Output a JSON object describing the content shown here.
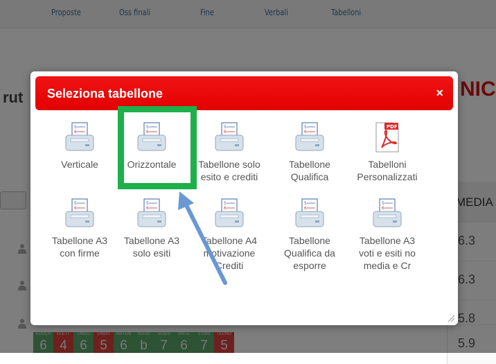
{
  "background": {
    "nav_items": [
      "Proposte",
      "Oss finali",
      "Fine",
      "Verbali",
      "Tabelloni"
    ],
    "left_title_fragment": "rut",
    "right_title_fragment": "NICA",
    "column_header": "MEDIA",
    "media_values": [
      "6.3",
      "6.3",
      "5.8",
      "5.9"
    ],
    "grade_labels": [
      "EDUCA",
      "ELETT",
      "LINGU",
      "LINGU",
      "MATEM",
      "RELIG",
      "SCIEN",
      "SISTE",
      "STORI",
      "TECNO"
    ],
    "grade_values": [
      "6",
      "4",
      "6",
      "5",
      "6",
      "b",
      "7",
      "6",
      "7",
      "5"
    ]
  },
  "modal": {
    "title": "Seleziona tabellone",
    "close_label": "×",
    "items": [
      {
        "label_lines": [
          "Verticale"
        ],
        "icon": "printer-icon"
      },
      {
        "label_lines": [
          "Orizzontale"
        ],
        "icon": "printer-icon"
      },
      {
        "label_lines": [
          "Tabellone solo",
          "esito e crediti"
        ],
        "icon": "printer-icon"
      },
      {
        "label_lines": [
          "Tabellone",
          "Qualifica"
        ],
        "icon": "printer-icon"
      },
      {
        "label_lines": [
          "Tabelloni",
          "Personalizzati"
        ],
        "icon": "pdf-icon"
      },
      {
        "label_lines": [
          "Tabellone A3",
          "con firme"
        ],
        "icon": "printer-icon"
      },
      {
        "label_lines": [
          "Tabellone A3",
          "solo esiti"
        ],
        "icon": "printer-icon"
      },
      {
        "label_lines": [
          "Tabellone A4",
          "motivazione",
          "Crediti"
        ],
        "icon": "printer-icon"
      },
      {
        "label_lines": [
          "Tabellone",
          "Qualifica da",
          "esporre"
        ],
        "icon": "printer-icon"
      },
      {
        "label_lines": [
          "Tabellone A3",
          "voti e esiti no",
          "media e Cr"
        ],
        "icon": "printer-icon"
      }
    ]
  },
  "colors": {
    "header_red": "#e30000",
    "highlight_green": "#1db04b",
    "arrow_blue": "#6a98d3",
    "grade_red": "#d9433f",
    "grade_green": "#5aa469"
  }
}
